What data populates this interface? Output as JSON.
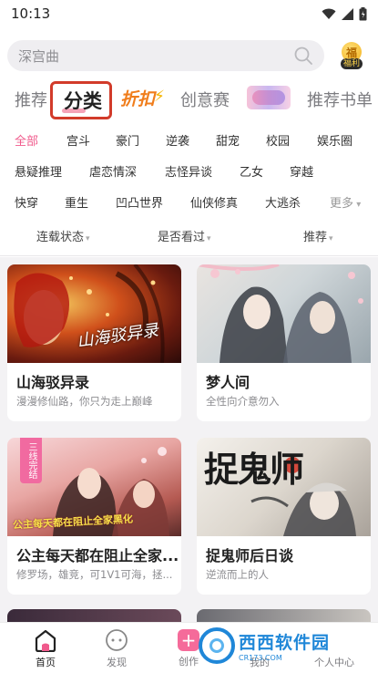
{
  "status_bar": {
    "time": "10:13"
  },
  "search": {
    "placeholder": "深宫曲"
  },
  "welfare": {
    "coin_glyph": "福",
    "label": "福利"
  },
  "top_tabs": [
    {
      "label": "推荐"
    },
    {
      "label": "分类"
    },
    {
      "label": "折扣"
    },
    {
      "label": "创意赛"
    },
    {
      "label": "推荐书单"
    }
  ],
  "genres": [
    [
      "全部",
      "宫斗",
      "豪门",
      "逆袭",
      "甜宠",
      "校园",
      "娱乐圈"
    ],
    [
      "悬疑推理",
      "虐恋情深",
      "志怪异谈",
      "乙女",
      "穿越"
    ],
    [
      "快穿",
      "重生",
      "凹凸世界",
      "仙侠修真",
      "大逃杀"
    ]
  ],
  "more_label": "更多",
  "filters": [
    {
      "label": "连载状态"
    },
    {
      "label": "是否看过"
    },
    {
      "label": "推荐"
    }
  ],
  "cards": [
    {
      "title": "山海驳异录",
      "desc": "漫漫修仙路，你只为走上巅峰",
      "cover_text": "山海驳异录"
    },
    {
      "title": "梦人间",
      "desc": "全性向介意勿入"
    },
    {
      "title": "公主每天都在阻止全家...",
      "desc": "修罗场，雄竞，可1V1可海，拯...",
      "cover_text": "公主每天都在阻止全家黑化",
      "badge": "三线完结"
    },
    {
      "title": "捉鬼师后日谈",
      "desc": "逆流而上的人",
      "cover_text": "捉鬼师"
    }
  ],
  "bottom_nav": [
    {
      "label": "首页"
    },
    {
      "label": "发现"
    },
    {
      "label": "创作"
    },
    {
      "label": "我的"
    },
    {
      "label": "个人中心"
    }
  ],
  "watermark": {
    "main": "西西软件园",
    "sub": "CR173.COM"
  },
  "colors": {
    "accent_pink": "#f05a8c",
    "highlight_border": "#d23b2a",
    "sale_orange": "#f07d1b"
  }
}
